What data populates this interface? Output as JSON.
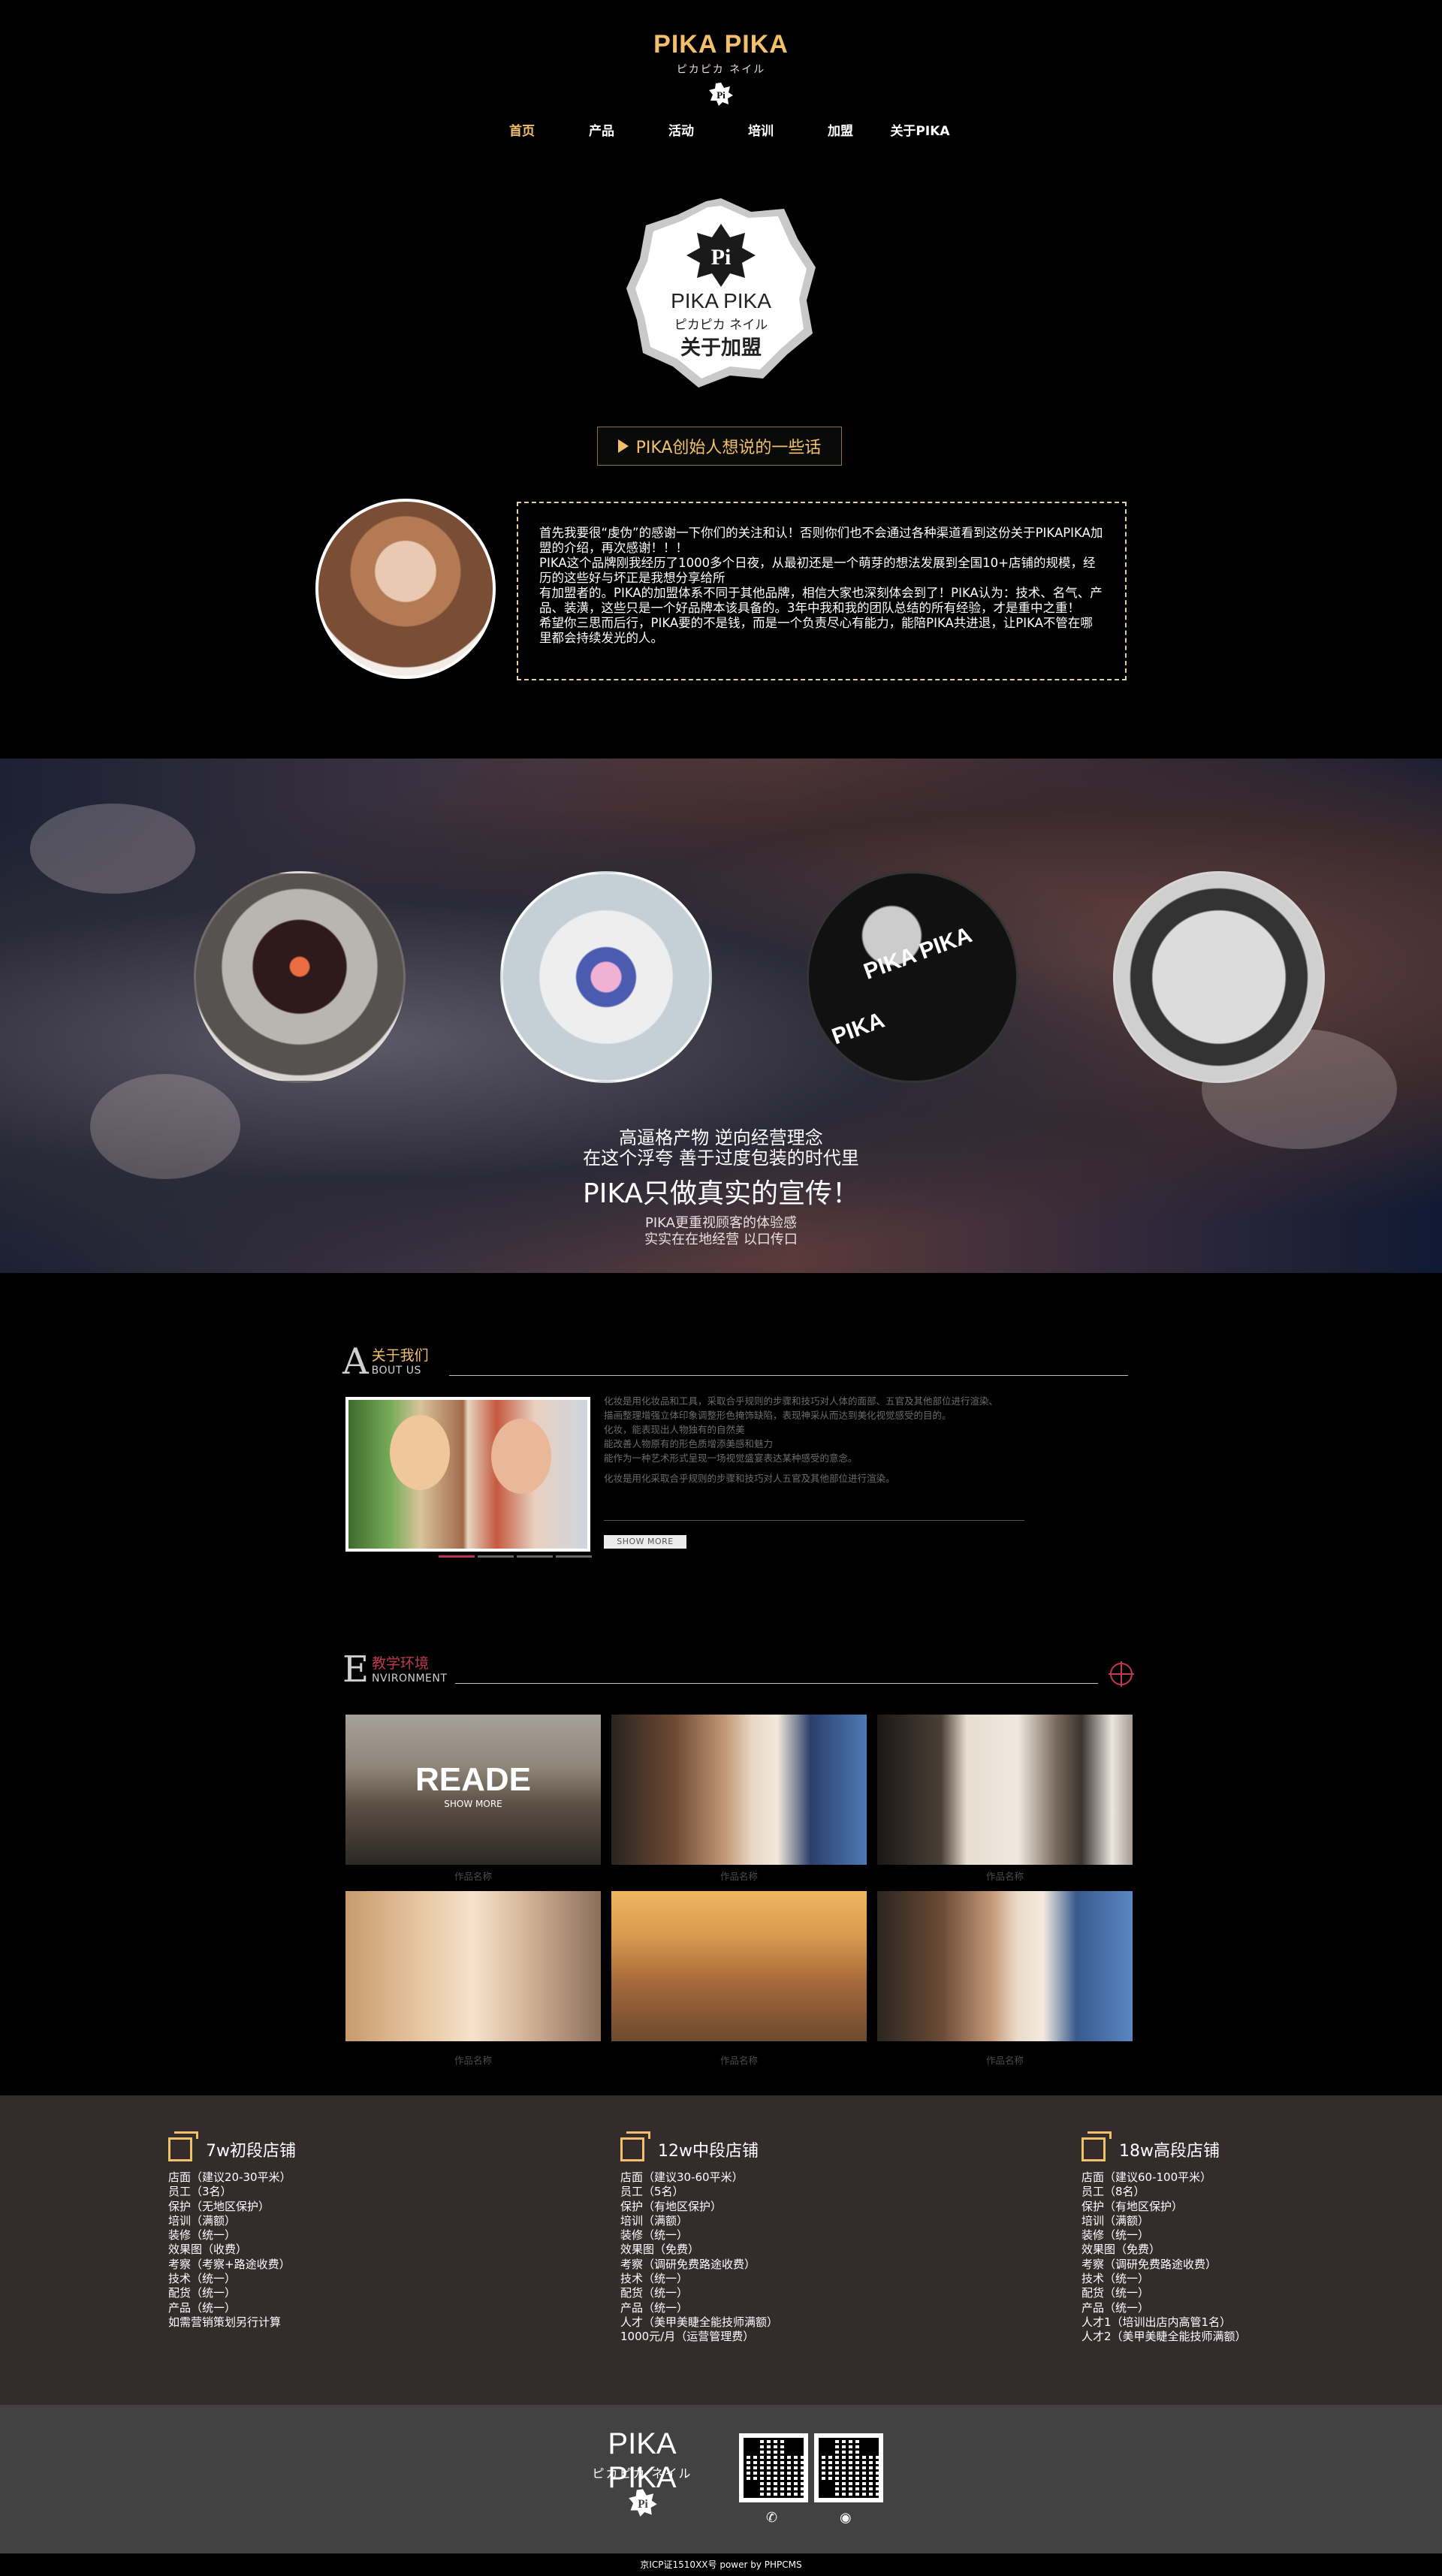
{
  "header": {
    "brand": "PIKA PIKA",
    "brand_sub": "ピカピカ ネイル",
    "nav": [
      {
        "label": "首页",
        "active": true
      },
      {
        "label": "产品",
        "active": false
      },
      {
        "label": "活动",
        "active": false
      },
      {
        "label": "培训",
        "active": false
      },
      {
        "label": "加盟",
        "active": false
      },
      {
        "label": "关于PIKA",
        "active": false
      }
    ]
  },
  "badge": {
    "brand": "PIKA PIKA",
    "brand_sub": "ピカピカ ネイル",
    "title": "关于加盟"
  },
  "founder": {
    "button_label": "PIKA创始人想说的一些话",
    "quote": [
      "首先我要很“虔伪”的感谢一下你们的关注和认！否则你们也不会通过各种渠道看到这份关于PIKAPIKA加盟的介绍，再次感谢！！！",
      "PIKA这个品牌刚我经历了1000多个日夜，从最初还是一个萌芽的想法发展到全国10+店铺的规模，经历的这些好与坏正是我想分享给所",
      "有加盟者的。PIKA的加盟体系不同于其他品牌，相信大家也深刻体会到了！PIKA认为：技术、名气、产品、装潢，这些只是一个好品牌本该具备的。3年中我和我的团队总结的所有经验，才是重中之重！",
      "希望你三思而后行，PIKA要的不是钱，而是一个负责尽心有能力，能陪PIKA共进退，让PIKA不管在哪里都会持续发光的人。"
    ]
  },
  "banner": {
    "line1": "高逼格产物  逆向经营理念",
    "line2": "在这个浮夸  善于过度包装的时代里",
    "headline": "PIKA只做真实的宣传！",
    "line4": "PIKA更重视顾客的体验感",
    "line5": "实实在在地经营  以口传口",
    "circle_text": [
      "PIKA PIKA",
      "PIKA"
    ]
  },
  "about": {
    "letter": "A",
    "title_cn": "关于我们",
    "title_en": "BOUT US",
    "paragraphs": [
      "化妆是用化妆品和工具，采取合乎规则的步骤和技巧对人体的面部、五官及其他部位进行渲染、",
      "描画整理增强立体印象调整形色掩饰缺陷，表现神采从而达到美化视觉感受的目的。",
      "化妆，能表现出人物独有的自然美",
      "能改善人物原有的形色质增添美感和魅力",
      "能作为一种艺术形式呈现一场视觉盛宴表达某种感受的意念。",
      "化妆是用化采取合乎规则的步骤和技巧对人五官及其他部位进行渲染。"
    ],
    "show_more": "SHOW MORE"
  },
  "environment": {
    "letter": "E",
    "title_cn": "教学环境",
    "title_en": "NVIRONMENT",
    "overlay_title": "READE",
    "overlay_sub": "SHOW MORE",
    "captions": [
      "作品名称",
      "作品名称",
      "作品名称",
      "作品名称",
      "作品名称",
      "作品名称"
    ]
  },
  "plans": [
    {
      "title": "7w初段店铺",
      "items": [
        "店面（建议20-30平米）",
        "员工（3名）",
        "保护（无地区保护）",
        "培训（满额）",
        "装修（统一）",
        "效果图（收费）",
        "考察（考察+路途收费）",
        "技术（统一）",
        "配货（统一）",
        "产品（统一）",
        "如需营销策划另行计算"
      ]
    },
    {
      "title": "12w中段店铺",
      "items": [
        "店面（建议30-60平米）",
        "员工（5名）",
        "保护（有地区保护）",
        "培训（满额）",
        "装修（统一）",
        "效果图（免费）",
        "考察（调研免费路途收费）",
        "技术（统一）",
        "配货（统一）",
        "产品（统一）",
        "人才（美甲美睫全能技师满额）",
        "1000元/月（运营管理费）"
      ]
    },
    {
      "title": "18w高段店铺",
      "items": [
        "店面（建议60-100平米）",
        "员工（8名）",
        "保护（有地区保护）",
        "培训（满额）",
        "装修（统一）",
        "效果图（免费）",
        "考察（调研免费路途收费）",
        "技术（统一）",
        "配货（统一）",
        "产品（统一）",
        "人才1（培训出店内高管1名）",
        "人才2（美甲美睫全能技师满额）"
      ]
    }
  ],
  "footer": {
    "brand": "PIKA PIKA",
    "brand_sub": "ピカピカ ネイル",
    "copyright": "京ICP证1510XX号  power by PHPCMS"
  },
  "colors": {
    "accent_gold": "#f2c06a",
    "env_red": "#c0394e",
    "plans_bg": "#342b2c",
    "footer_bg": "#424242"
  }
}
